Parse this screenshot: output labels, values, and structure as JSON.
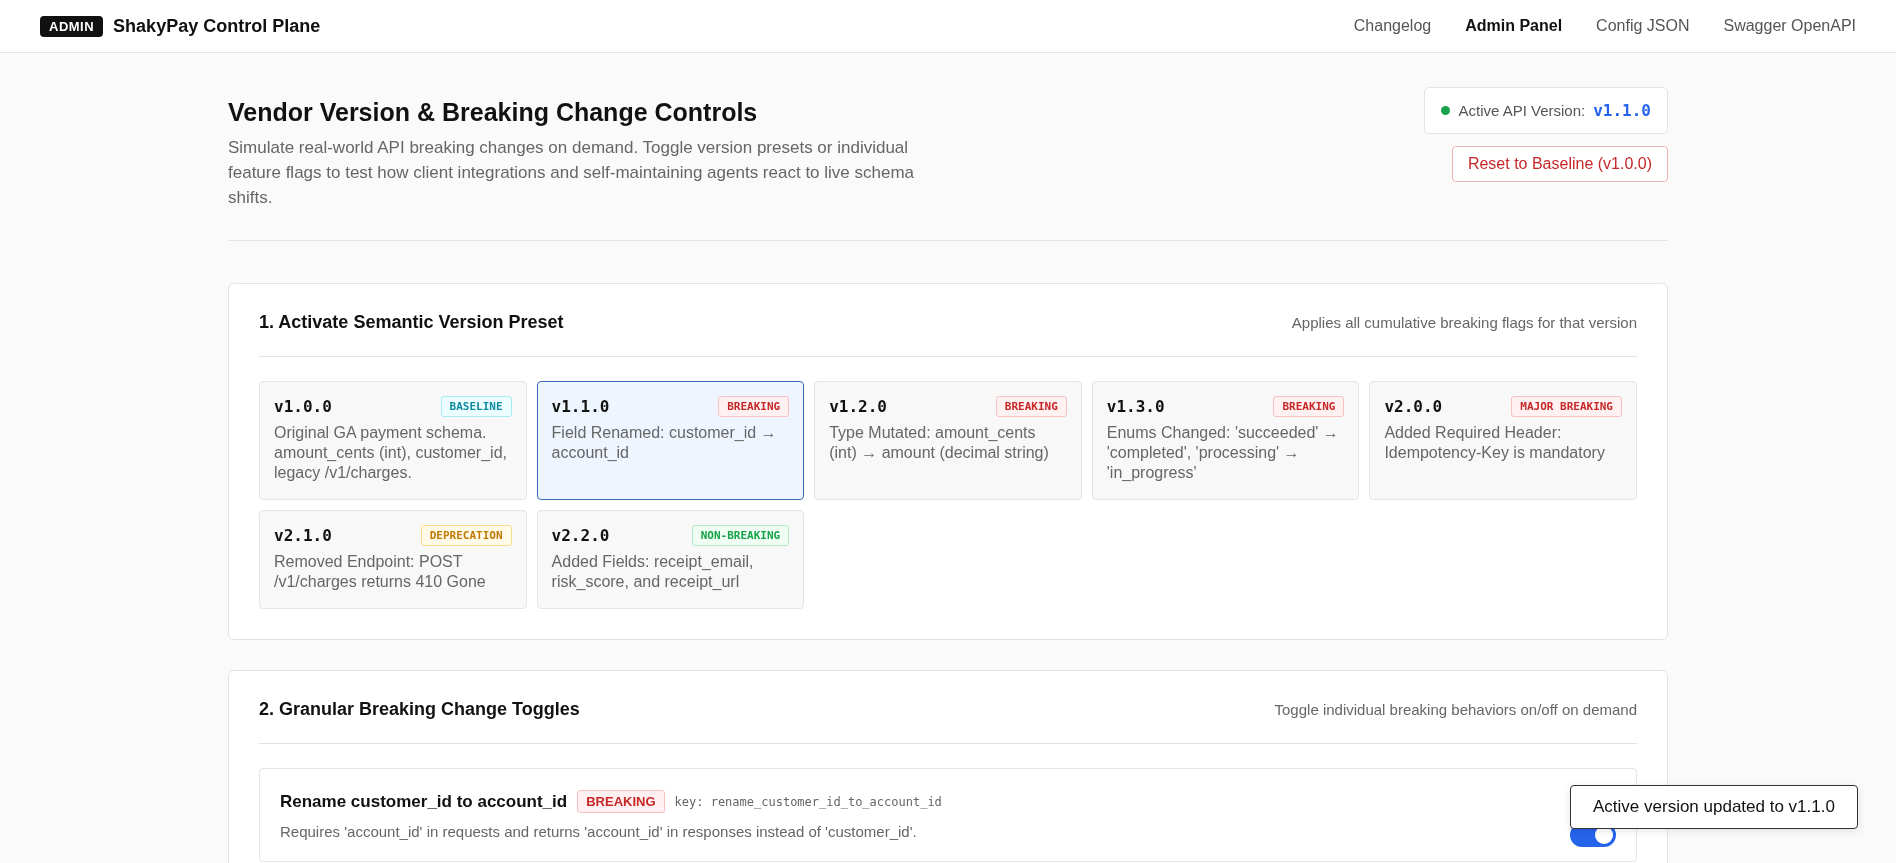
{
  "header": {
    "badge": "ADMIN",
    "title": "ShakyPay Control Plane",
    "nav": [
      {
        "label": "Changelog",
        "selected": false
      },
      {
        "label": "Admin Panel",
        "selected": true
      },
      {
        "label": "Config JSON",
        "selected": false
      },
      {
        "label": "Swagger OpenAPI",
        "selected": false
      }
    ]
  },
  "intro": {
    "title": "Vendor Version & Breaking Change Controls",
    "description": "Simulate real-world API breaking changes on demand. Toggle version presets or individual feature flags to test how client integrations and self-maintaining agents react to live schema shifts.",
    "status_label": "Active API Version:",
    "status_value": "v1.1.0",
    "reset_button": "Reset to Baseline (v1.0.0)"
  },
  "presets": {
    "title": "1. Activate Semantic Version Preset",
    "hint": "Applies all cumulative breaking flags for that version",
    "items": [
      {
        "version": "v1.0.0",
        "badge": "BASELINE",
        "kind": "baseline",
        "description": "Original GA payment schema. amount_cents (int), customer_id, legacy /v1/charges.",
        "selected": false
      },
      {
        "version": "v1.1.0",
        "badge": "BREAKING",
        "kind": "breaking",
        "description": "Field Renamed: customer_id → account_id",
        "selected": true
      },
      {
        "version": "v1.2.0",
        "badge": "BREAKING",
        "kind": "breaking",
        "description": "Type Mutated: amount_cents (int) → amount (decimal string)",
        "selected": false
      },
      {
        "version": "v1.3.0",
        "badge": "BREAKING",
        "kind": "breaking",
        "description": "Enums Changed: 'succeeded' → 'completed', 'processing' → 'in_progress'",
        "selected": false
      },
      {
        "version": "v2.0.0",
        "badge": "MAJOR BREAKING",
        "kind": "breaking",
        "description": "Added Required Header: Idempotency-Key is mandatory",
        "selected": false
      },
      {
        "version": "v2.1.0",
        "badge": "DEPRECATION",
        "kind": "deprecation",
        "description": "Removed Endpoint: POST /v1/charges returns 410 Gone",
        "selected": false
      },
      {
        "version": "v2.2.0",
        "badge": "NON-BREAKING",
        "kind": "nonbreaking",
        "description": "Added Fields: receipt_email, risk_score, and receipt_url",
        "selected": false
      }
    ]
  },
  "toggles": {
    "title": "2. Granular Breaking Change Toggles",
    "hint": "Toggle individual breaking behaviors on/off on demand",
    "items": [
      {
        "name": "Rename customer_id to account_id",
        "badge": "BREAKING",
        "kind": "breaking",
        "key": "key: rename_customer_id_to_account_id",
        "description": "Requires 'account_id' in requests and returns 'account_id' in responses instead of 'customer_id'.",
        "on": true
      }
    ]
  },
  "toast": "Active version updated to v1.1.0"
}
